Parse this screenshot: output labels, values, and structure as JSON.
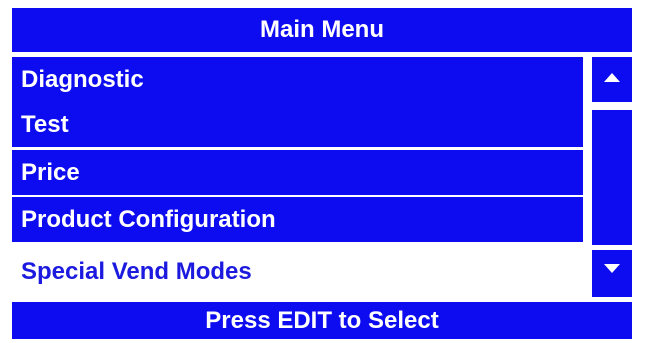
{
  "header": {
    "title": "Main Menu"
  },
  "menu": {
    "items": [
      {
        "label": "Diagnostic",
        "selected": false
      },
      {
        "label": "Test",
        "selected": false
      },
      {
        "label": "Price",
        "selected": false
      },
      {
        "label": "Product Configuration",
        "selected": false
      },
      {
        "label": "Special Vend Modes",
        "selected": true
      }
    ]
  },
  "scrollbar": {
    "up_icon": "triangle-up",
    "down_icon": "triangle-down"
  },
  "footer": {
    "hint": "Press EDIT to Select"
  },
  "colors": {
    "panel": "#0d0bf0",
    "text": "#ffffff",
    "selected_text": "#1c1adf",
    "background": "#ffffff"
  }
}
